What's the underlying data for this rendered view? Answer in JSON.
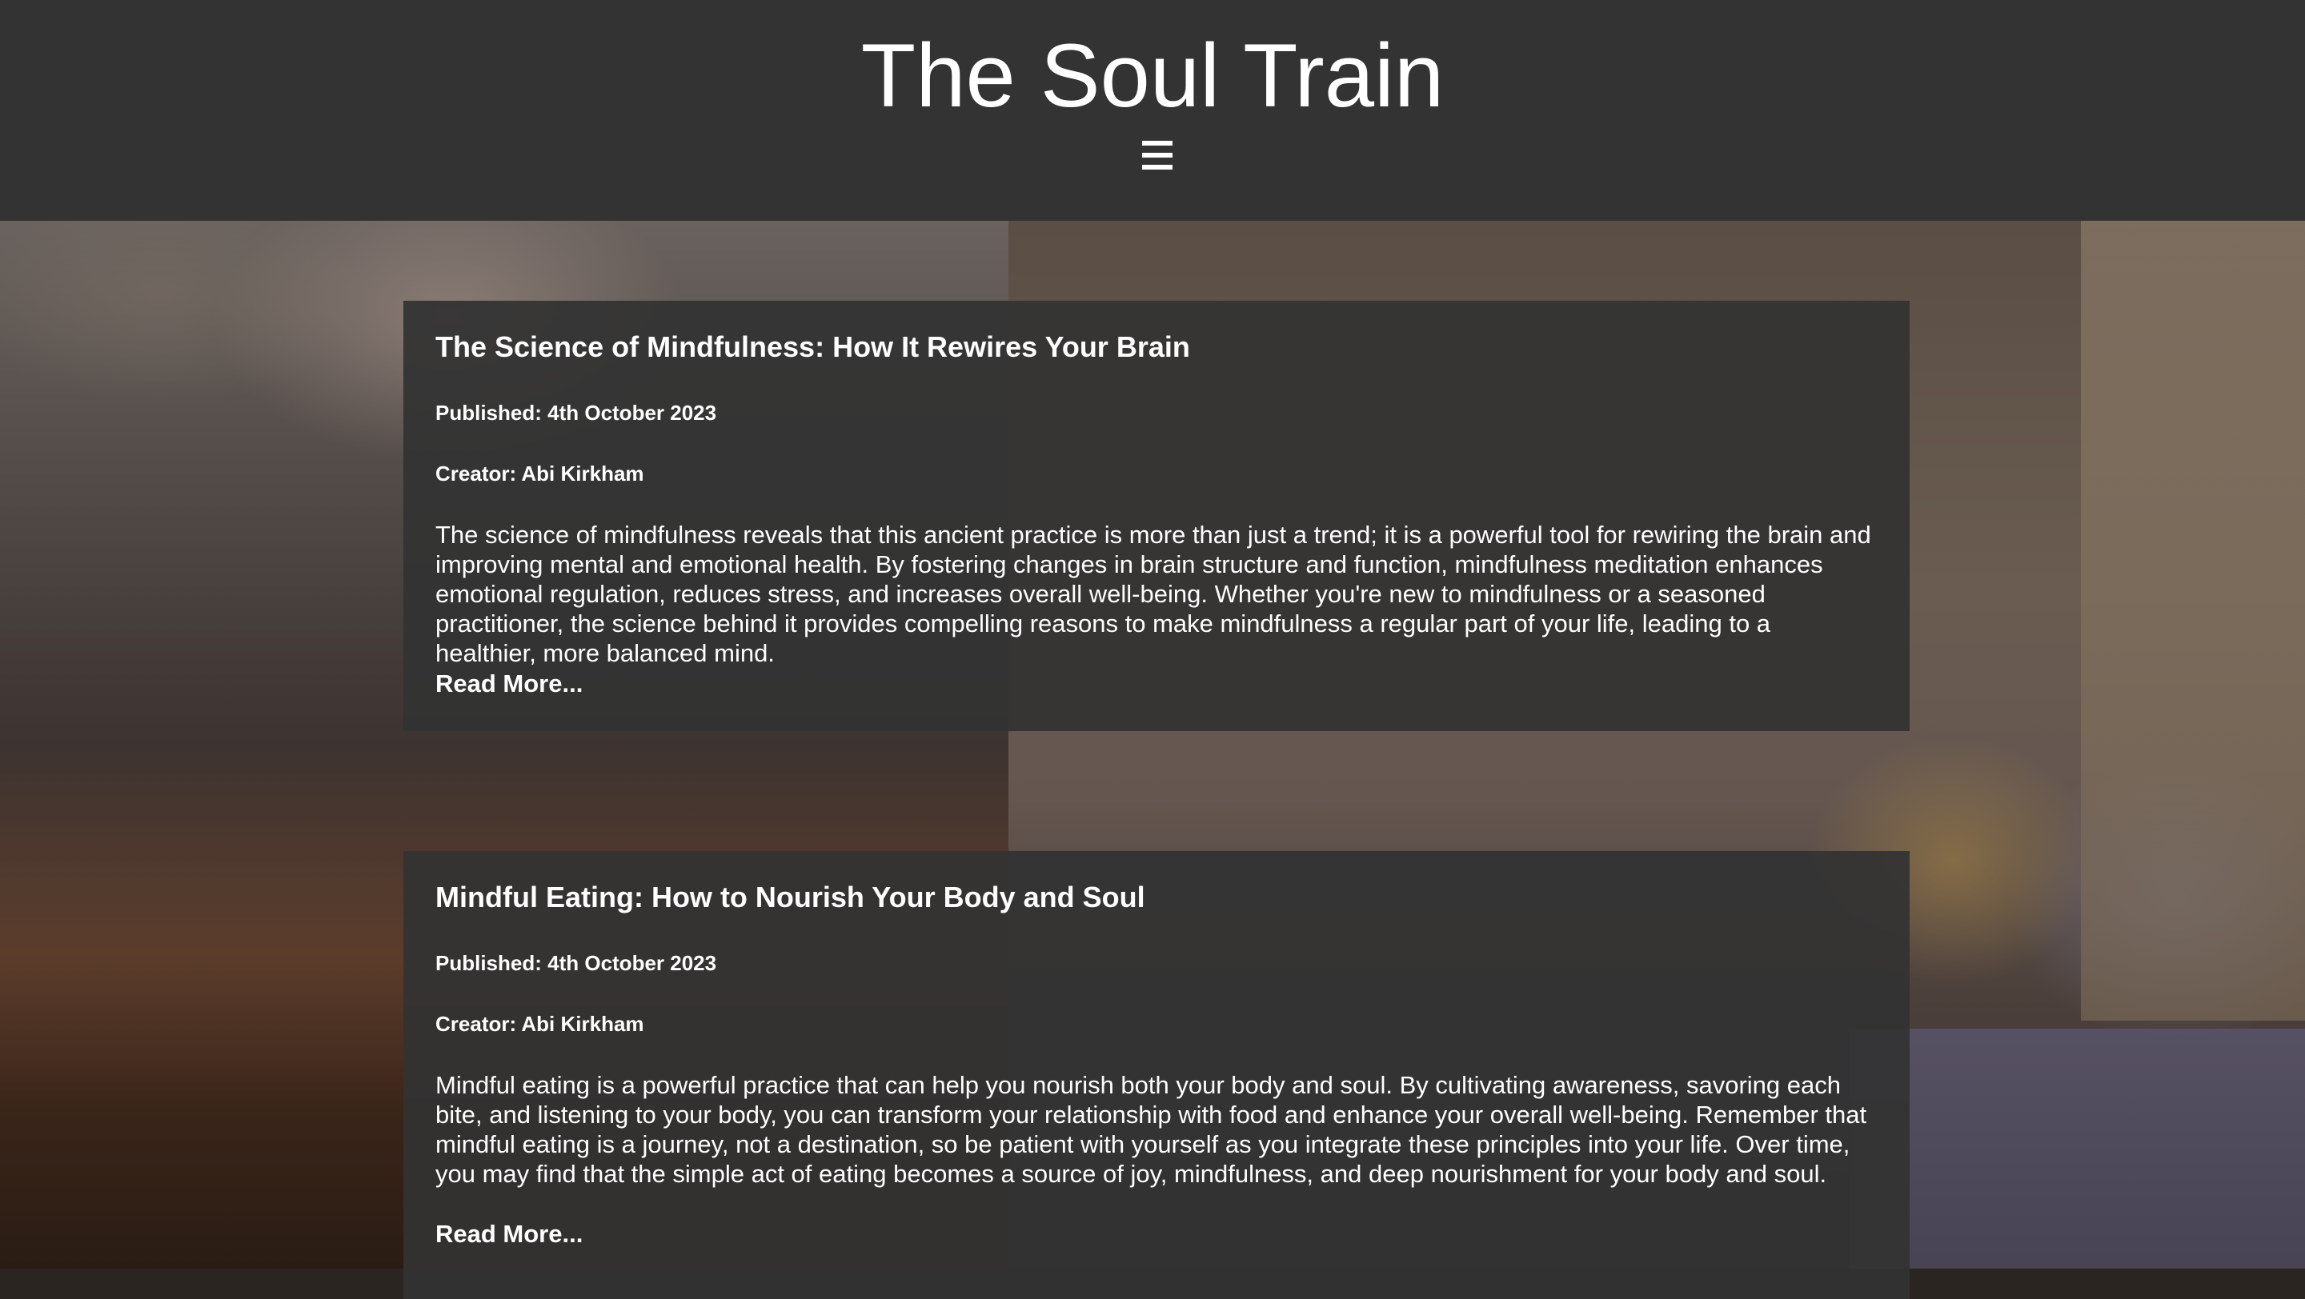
{
  "header": {
    "title": "The Soul Train",
    "menu_icon": "hamburger-menu-icon"
  },
  "colors": {
    "header_bg": "#333333",
    "card_bg": "#333333",
    "text": "#ffffff"
  },
  "posts": [
    {
      "title": "The Science of Mindfulness: How It Rewires Your Brain",
      "published": "Published: 4th October 2023",
      "creator": "Creator: Abi Kirkham",
      "body": "The science of mindfulness reveals that this ancient practice is more than just a trend; it is a powerful tool for rewiring the brain and improving mental and emotional health. By fostering changes in brain structure and function, mindfulness meditation enhances emotional regulation, reduces stress, and increases overall well-being. Whether you're new to mindfulness or a seasoned practitioner, the science behind it provides compelling reasons to make mindfulness a regular part of your life, leading to a healthier, more balanced mind.",
      "read_more": "Read More..."
    },
    {
      "title": "Mindful Eating: How to Nourish Your Body and Soul",
      "published": "Published: 4th October 2023",
      "creator": "Creator: Abi Kirkham",
      "body": "Mindful eating is a powerful practice that can help you nourish both your body and soul. By cultivating awareness, savoring each bite, and listening to your body, you can transform your relationship with food and enhance your overall well-being. Remember that mindful eating is a journey, not a destination, so be patient with yourself as you integrate these principles into your life. Over time, you may find that the simple act of eating becomes a source of joy, mindfulness, and deep nourishment for your body and soul.",
      "read_more": "Read More..."
    }
  ]
}
